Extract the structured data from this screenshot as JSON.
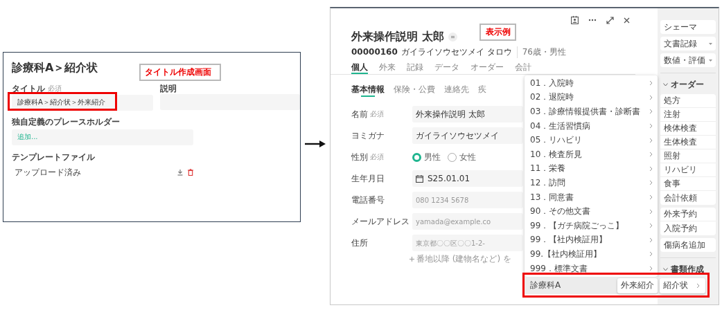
{
  "title_screen": {
    "title": "診療科A＞紹介状",
    "annotation": "タイトル作成画面",
    "fields": [
      {
        "label": "タイトル",
        "required": "必須",
        "value": "診療科A＞紹介状＞外来紹介",
        "highlighted": true
      },
      {
        "label": "説明",
        "highlighted": false
      }
    ],
    "placeholder_section": {
      "label": "独自定義のプレースホルダー",
      "add_link": "追加..."
    },
    "template": {
      "label": "テンプレートファイル",
      "status": "アップロード済み"
    }
  },
  "patient_window": {
    "annotation": "表示例",
    "patient_name": "外来操作説明 太郎",
    "patient_id": "00000160",
    "kana": "ガイライソウセツメイ タロウ",
    "age_sex": "76歳・男性",
    "tabs": [
      {
        "label": "個人",
        "selected": true
      },
      {
        "label": "外来",
        "selected": false
      },
      {
        "label": "記録",
        "selected": false
      },
      {
        "label": "データ",
        "selected": false
      },
      {
        "label": "オーダー",
        "selected": false
      },
      {
        "label": "会計",
        "selected": false
      }
    ],
    "subtabs": [
      {
        "label": "基本情報",
        "selected": true
      },
      {
        "label": "保険・公費",
        "selected": false
      },
      {
        "label": "連絡先",
        "selected": false
      },
      {
        "label": "疾",
        "selected": false
      }
    ],
    "form": [
      {
        "kind": "text",
        "label": "名前",
        "required": "必須",
        "value": "外来操作説明 太郎"
      },
      {
        "kind": "text",
        "label": "ヨミガナ",
        "value": "ガイライソウセツメイ"
      },
      {
        "kind": "radio",
        "label": "性別",
        "required": "必須",
        "options": [
          {
            "label": "男性",
            "selected": true
          },
          {
            "label": "女性",
            "selected": false
          }
        ]
      },
      {
        "kind": "date",
        "label": "生年月日",
        "value": "S25.01.01"
      },
      {
        "kind": "text",
        "label": "電話番号",
        "placeholder": "080 1234 5678"
      },
      {
        "kind": "text",
        "label": "メールアドレス",
        "placeholder": "yamada@example.co"
      },
      {
        "kind": "text",
        "label": "住所",
        "placeholder": "東京都〇〇区〇〇1-2-",
        "hint": "番地以降 (建物名など) を"
      }
    ],
    "document_menu": [
      "01．入院時",
      "02．退院時",
      "03．診療情報提供書・診断書",
      "04．生活習慣病",
      "05．リハビリ",
      "10．検査所見",
      "11．栄養",
      "12．訪問",
      "13．同意書",
      "90．その他文書",
      "99．【ガチ病院ごっこ】",
      "99．【社内検証用】",
      "99.【社内検証用】",
      "999．標準文書"
    ],
    "menu_path": {
      "highlighted": true,
      "department": "診療科A",
      "template": "外来紹介",
      "document": "紹介状"
    },
    "sidebar": [
      {
        "kind": "group",
        "items": [
          {
            "label": "シェーマ",
            "dropdown": false
          }
        ]
      },
      {
        "kind": "group",
        "items": [
          {
            "label": "文書記録",
            "dropdown": true
          }
        ]
      },
      {
        "kind": "group",
        "items": [
          {
            "label": "数値・評価",
            "dropdown": true
          }
        ]
      },
      {
        "kind": "section",
        "label": "オーダー",
        "expanded": true
      },
      {
        "kind": "group",
        "items": [
          {
            "label": "処方",
            "dropdown": false
          },
          {
            "label": "注射",
            "dropdown": false
          },
          {
            "label": "検体検査",
            "dropdown": false
          },
          {
            "label": "生体検査",
            "dropdown": false
          },
          {
            "label": "照射",
            "dropdown": false
          },
          {
            "label": "リハビリ",
            "dropdown": false
          },
          {
            "label": "食事",
            "dropdown": false
          },
          {
            "label": "会計依頼",
            "dropdown": false
          }
        ]
      },
      {
        "kind": "group",
        "items": [
          {
            "label": "外来予約",
            "dropdown": false
          },
          {
            "label": "入院予約",
            "dropdown": false
          }
        ]
      },
      {
        "kind": "group",
        "items": [
          {
            "label": "傷病名追加",
            "dropdown": false
          }
        ]
      },
      {
        "kind": "section",
        "label": "書類作成",
        "expanded": true
      }
    ]
  }
}
